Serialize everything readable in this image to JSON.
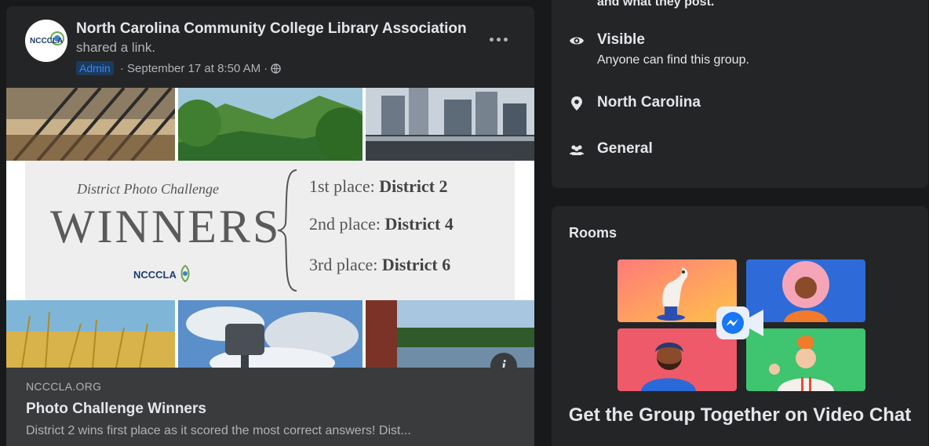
{
  "post": {
    "author": "North Carolina Community College Library Association",
    "action": "shared a link.",
    "badge": "Admin",
    "timestamp": "· September 17 at 8:50 AM ·",
    "avatar_text": "NCCCLA",
    "more_icon": "more-options-icon",
    "privacy_icon": "globe-icon"
  },
  "collage": {
    "subtitle": "District Photo Challenge",
    "headline": "WINNERS",
    "logo_text": "NCCCLA",
    "places": [
      {
        "label": "1st place: ",
        "value": "District 2"
      },
      {
        "label": "2nd place: ",
        "value": "District 4"
      },
      {
        "label": "3rd place: ",
        "value": "District 6"
      }
    ],
    "info_icon": "info-icon",
    "info_glyph": "i"
  },
  "link": {
    "domain": "NCCCLA.ORG",
    "title": "Photo Challenge Winners",
    "description": "District 2 wins first place as it scored the most correct answers! Dist..."
  },
  "about": {
    "cutoff_text": "and what they post.",
    "rows": [
      {
        "icon": "eye-icon",
        "label": "Visible",
        "sub": "Anyone can find this group."
      },
      {
        "icon": "location-pin-icon",
        "label": "North Carolina"
      },
      {
        "icon": "group-icon",
        "label": "General"
      }
    ]
  },
  "rooms": {
    "title": "Rooms",
    "cta": "Get the Group Together on Video Chat",
    "messenger_icon": "messenger-rooms-icon"
  }
}
